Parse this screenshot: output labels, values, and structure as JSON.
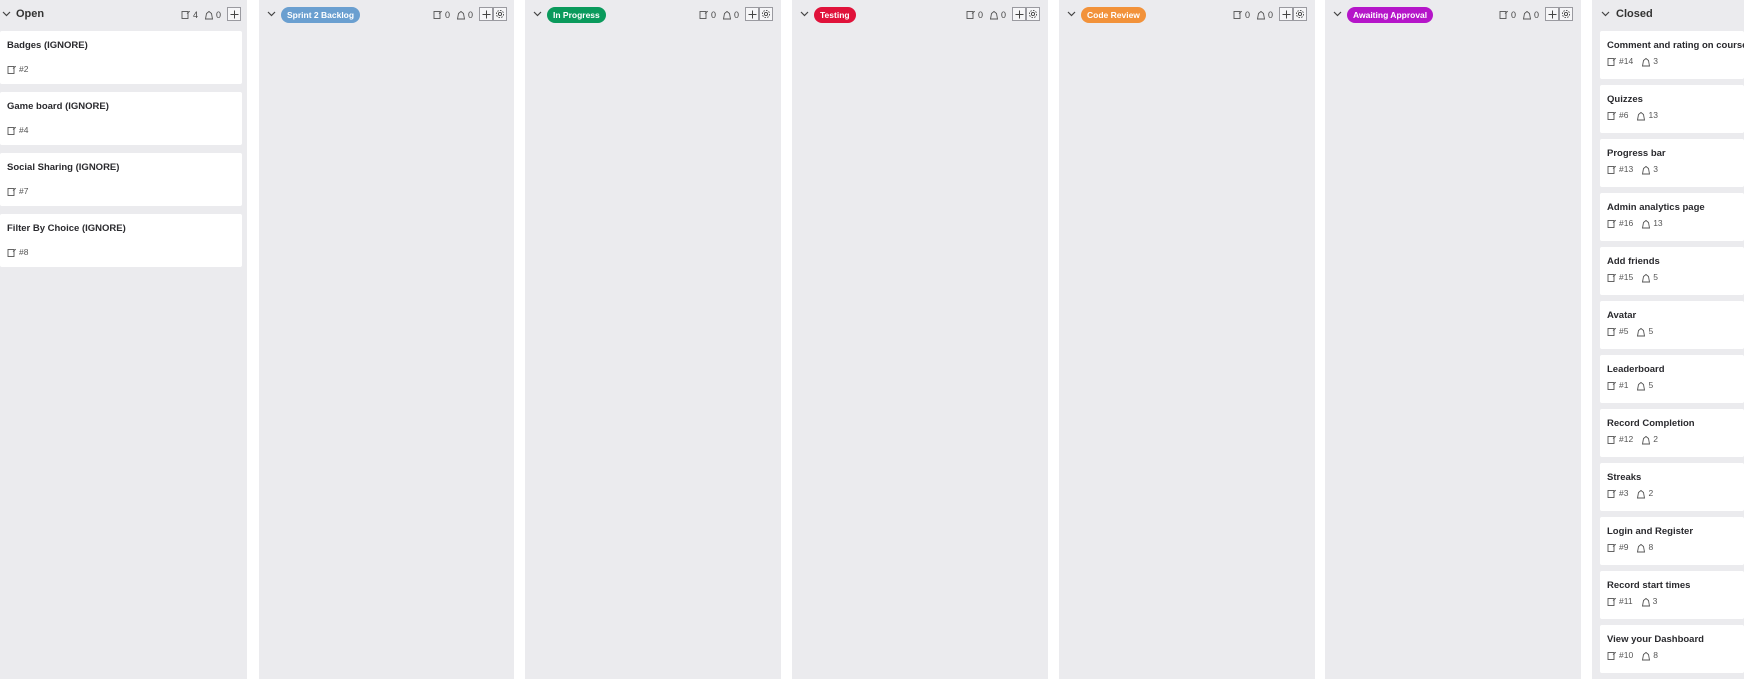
{
  "colors": {
    "column_bg": "#ebebee",
    "card_bg": "#ffffff",
    "sprint2_backlog": "#6a9fd0",
    "in_progress": "#0a9a5c",
    "testing": "#e0123a",
    "code_review": "#f2923a",
    "awaiting_approval": "#b515c9"
  },
  "columns": {
    "open": {
      "title": "Open",
      "issues_count": "4",
      "pr_count": "0",
      "cards": [
        {
          "title": "Badges (IGNORE)",
          "number": "#2"
        },
        {
          "title": "Game board (IGNORE)",
          "number": "#4"
        },
        {
          "title": "Social Sharing (IGNORE)",
          "number": "#7"
        },
        {
          "title": "Filter By Choice (IGNORE)",
          "number": "#8"
        }
      ]
    },
    "sprint2_backlog": {
      "title": "Sprint 2 Backlog",
      "issues_count": "0",
      "pr_count": "0"
    },
    "in_progress": {
      "title": "In Progress",
      "issues_count": "0",
      "pr_count": "0"
    },
    "testing": {
      "title": "Testing",
      "issues_count": "0",
      "pr_count": "0"
    },
    "code_review": {
      "title": "Code Review",
      "issues_count": "0",
      "pr_count": "0"
    },
    "awaiting_approval": {
      "title": "Awaiting Approval",
      "issues_count": "0",
      "pr_count": "0"
    },
    "closed": {
      "title": "Closed",
      "cards": [
        {
          "title": "Comment and rating on course",
          "number": "#14",
          "weight": "3"
        },
        {
          "title": "Quizzes",
          "number": "#6",
          "weight": "13"
        },
        {
          "title": "Progress bar",
          "number": "#13",
          "weight": "3"
        },
        {
          "title": "Admin analytics page",
          "number": "#16",
          "weight": "13"
        },
        {
          "title": "Add friends",
          "number": "#15",
          "weight": "5"
        },
        {
          "title": "Avatar",
          "number": "#5",
          "weight": "5"
        },
        {
          "title": "Leaderboard",
          "number": "#1",
          "weight": "5"
        },
        {
          "title": "Record Completion",
          "number": "#12",
          "weight": "2"
        },
        {
          "title": "Streaks",
          "number": "#3",
          "weight": "2"
        },
        {
          "title": "Login and Register",
          "number": "#9",
          "weight": "8"
        },
        {
          "title": "Record start times",
          "number": "#11",
          "weight": "3"
        },
        {
          "title": "View your Dashboard",
          "number": "#10",
          "weight": "8"
        }
      ]
    }
  }
}
